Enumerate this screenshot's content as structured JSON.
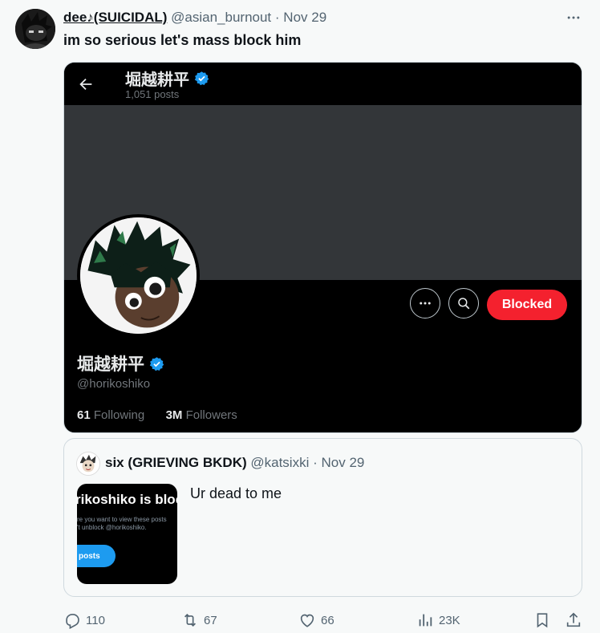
{
  "post": {
    "display_name": "dee♪(SUICIDAL)",
    "handle": "@asian_burnout",
    "separator": "·",
    "date": "Nov 29",
    "text": "im so serious let's mass block him",
    "more_icon": "more-horizontal-icon"
  },
  "embedded_profile": {
    "top_name": "堀越耕平",
    "post_count": "1,051 posts",
    "name": "堀越耕平",
    "handle": "@horikoshiko",
    "following_count": "61",
    "following_label": "Following",
    "followers_count": "3M",
    "followers_label": "Followers",
    "blocked_label": "Blocked",
    "colors": {
      "blocked": "#f4212e",
      "verified": "#1d9bf0",
      "banner": "#333639"
    }
  },
  "quote": {
    "display_name": "six (GRIEVING BKDK)",
    "handle": "@katsixki",
    "separator": "·",
    "date": "Nov 29",
    "text": "Ur dead to me",
    "thumbnail": {
      "title": "rikoshiko is bloc",
      "line1": "re you want to view these posts",
      "line2": "'t unblock @horikoshiko.",
      "button": "posts"
    }
  },
  "actions": {
    "replies": "110",
    "reposts": "67",
    "likes": "66",
    "views": "23K"
  }
}
